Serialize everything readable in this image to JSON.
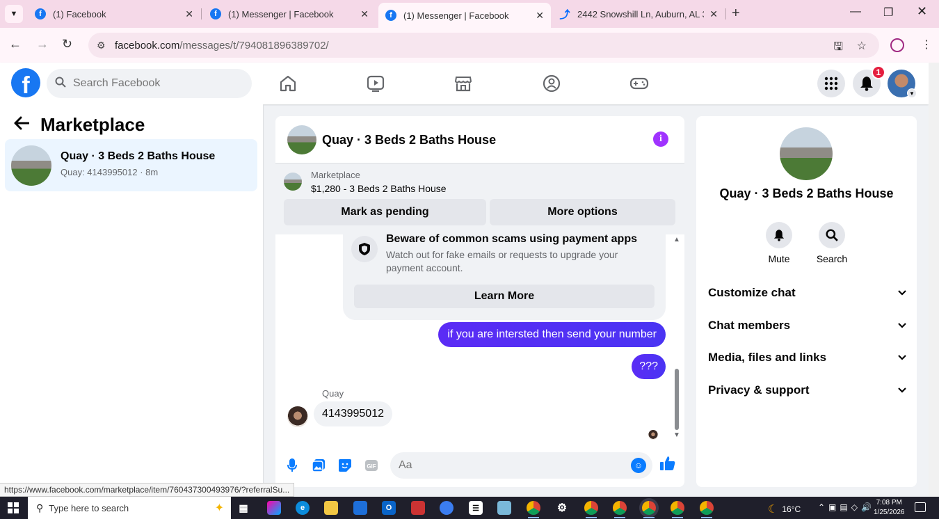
{
  "browser": {
    "tabs": [
      {
        "title": "(1) Facebook",
        "icon": "facebook-icon",
        "active": false
      },
      {
        "title": "(1) Messenger | Facebook",
        "icon": "facebook-icon",
        "active": false
      },
      {
        "title": "(1) Messenger | Facebook",
        "icon": "facebook-icon",
        "active": true
      },
      {
        "title": "2442 Snowshill Ln, Auburn, AL 3",
        "icon": "zillow-icon",
        "active": false
      }
    ],
    "url_domain": "facebook.com",
    "url_path": "/messages/t/794081896389702/",
    "status_url": "https://www.facebook.com/marketplace/item/760437300493976/?referralSu..."
  },
  "fb_header": {
    "logo": "f",
    "search_placeholder": "Search Facebook",
    "notification_count": "1"
  },
  "sidebar": {
    "title": "Marketplace",
    "conversation": {
      "name": "Quay · 3 Beds 2 Baths House",
      "preview": "Quay: 4143995012 · 8m"
    }
  },
  "chat": {
    "title": "Quay · 3 Beds 2 Baths House",
    "marketplace_label": "Marketplace",
    "listing": "$1,280 - 3 Beds 2 Baths House",
    "mark_pending_label": "Mark as pending",
    "more_options_label": "More options",
    "scam_title": "Beware of common scams using payment apps",
    "scam_body": "Watch out for fake emails or requests to upgrade your payment account.",
    "learn_more_label": "Learn More",
    "messages": [
      {
        "direction": "out",
        "text": "if you are intersted then send your number"
      },
      {
        "direction": "out",
        "text": "???"
      },
      {
        "direction": "in",
        "sender": "Quay",
        "text": "4143995012"
      }
    ],
    "composer_placeholder": "Aa"
  },
  "info_panel": {
    "title": "Quay · 3 Beds 2 Baths House",
    "actions": [
      {
        "label": "Mute",
        "icon": "bell-icon"
      },
      {
        "label": "Search",
        "icon": "search-icon"
      }
    ],
    "sections": [
      {
        "label": "Customize chat"
      },
      {
        "label": "Chat members"
      },
      {
        "label": "Media, files and links"
      },
      {
        "label": "Privacy & support"
      }
    ]
  },
  "taskbar": {
    "search_placeholder": "Type here to search",
    "temperature": "16°C",
    "time": "7:08 PM",
    "date": "1/25/2026"
  },
  "colors": {
    "facebook_blue": "#1877f2",
    "messenger_purple": "#4a34f3",
    "info_purple": "#a033ff",
    "notification_red": "#e41e3f"
  }
}
